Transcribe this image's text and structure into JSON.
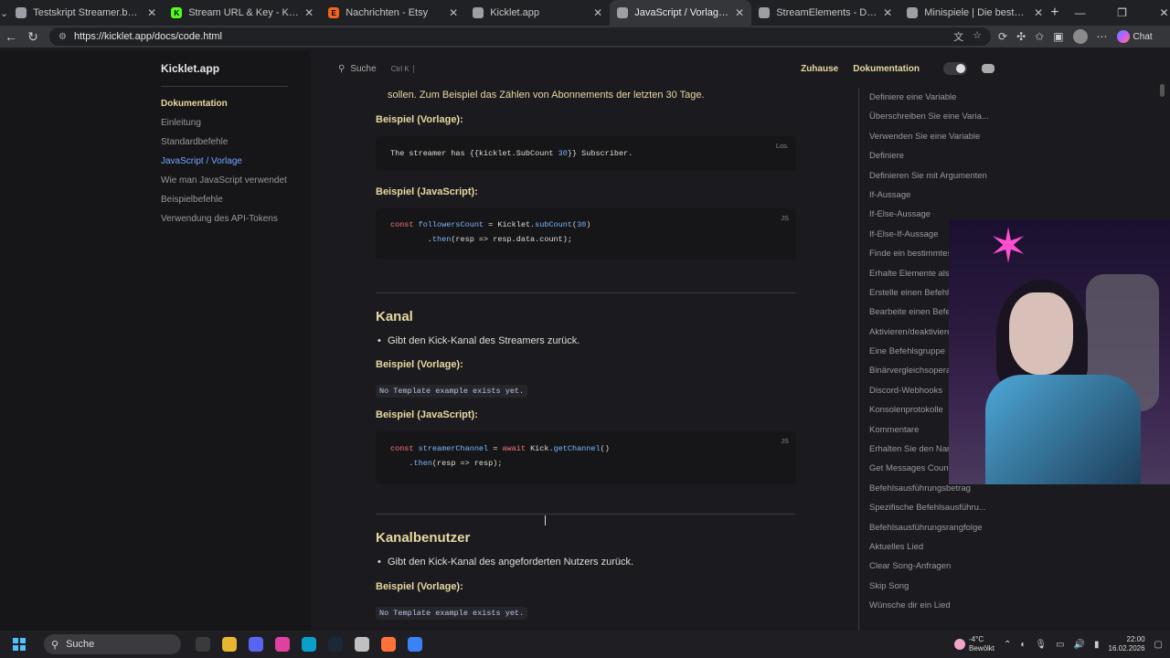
{
  "browser": {
    "tabs": [
      {
        "title": "Testskript Streamer.bot Kick",
        "fav_color": "#9aa0a6",
        "fav_glyph": ""
      },
      {
        "title": "Stream URL & Key - Kick Dashboard",
        "fav_color": "#53fc18",
        "fav_glyph": "K"
      },
      {
        "title": "Nachrichten - Etsy",
        "fav_color": "#f1641e",
        "fav_glyph": "E"
      },
      {
        "title": "Kicklet.app",
        "fav_color": "#9aa0a6",
        "fav_glyph": ""
      },
      {
        "title": "JavaScript / Vorlage | Kicklet.app",
        "fav_color": "#9aa0a6",
        "fav_glyph": ""
      },
      {
        "title": "StreamElements - Default comma",
        "fav_color": "#9aa0a6",
        "fav_glyph": ""
      },
      {
        "title": "Minispiele | Die beste Software zu",
        "fav_color": "#9aa0a6",
        "fav_glyph": ""
      }
    ],
    "url": "https://kicklet.app/docs/code.html",
    "chat_label": "Chat"
  },
  "site": {
    "brand": "Kicklet.app",
    "search_label": "Suche",
    "search_kbd": "Ctrl K",
    "nav": {
      "home": "Zuhause",
      "docs": "Dokumentation"
    }
  },
  "sidebar": {
    "items": [
      {
        "label": "Dokumentation",
        "kind": "section"
      },
      {
        "label": "Einleitung",
        "kind": "item"
      },
      {
        "label": "Standardbefehle",
        "kind": "item"
      },
      {
        "label": "JavaScript / Vorlage",
        "kind": "active"
      },
      {
        "label": "Wie man JavaScript verwendet",
        "kind": "item"
      },
      {
        "label": "Beispielbefehle",
        "kind": "item"
      },
      {
        "label": "Verwendung des API-Tokens",
        "kind": "item"
      }
    ]
  },
  "content": {
    "intro_line": "sollen. Zum Beispiel das Zählen von Abonnements der letzten 30 Tage.",
    "example_template_label": "Beispiel (Vorlage):",
    "example_js_label": "Beispiel (JavaScript):",
    "code1_lang": "Los.",
    "code1_text_a": "The streamer has {{kicklet.SubCount ",
    "code1_num": "30",
    "code1_text_b": "}} Subscriber.",
    "code2_lang": "JS",
    "code2": {
      "const": "const",
      "var": "followersCount",
      "eq": " = Kicklet.",
      "fn": "subCount",
      "open": "(",
      "num": "30",
      "close": ")",
      "line2_a": "        .",
      "then": "then",
      "line2_b": "(resp => resp.data.count);"
    },
    "sec1_heading": "Kanal",
    "sec1_bullet": "Gibt den Kick-Kanal des Streamers zurück.",
    "no_template": "No Template example exists yet.",
    "code3_lang": "JS",
    "code3": {
      "const": "const",
      "var": "streamerChannel",
      "eq": " = ",
      "await": "await",
      "obj": " Kick.",
      "fn": "getChannel",
      "paren": "()",
      "line2_a": "    .",
      "then": "then",
      "line2_b": "(resp => resp);"
    },
    "sec2_heading": "Kanalbenutzer",
    "sec2_bullet": "Gibt den Kick-Kanal des angeforderten Nutzers zurück."
  },
  "toc": {
    "items": [
      "Definiere eine Variable",
      "Überschreiben Sie eine Varia...",
      "Verwenden Sie eine Variable",
      "Definiere",
      "Definieren Sie mit Argumenten",
      "If-Aussage",
      "If-Else-Aussage",
      "If-Else-If-Aussage",
      "Finde ein bestimmtes Element",
      "Erhalte Elemente als Liste",
      "Erstelle einen Befehl",
      "Bearbeite einen Befehl",
      "Aktivieren/deaktivieren",
      "Eine Befehlsgruppe",
      "Binärvergleichsoperatoren",
      "Discord-Webhooks",
      "Konsolenprotokolle",
      "Kommentare",
      "Erhalten Sie den Namen",
      "Get Messages Count",
      "Befehlsausführungsbetrag",
      "Spezifische Befehlsausführu...",
      "Befehlsausführungsrangfolge",
      "Aktuelles Lied",
      "Clear Song-Anfragen",
      "Skip Song",
      "Wünsche dir ein Lied"
    ]
  },
  "taskbar": {
    "search": "Suche",
    "weather_temp": "-4°C",
    "weather_desc": "Bewölkt",
    "time": "22:00",
    "date": "16.02.2026",
    "apps": [
      "#3a3a3a",
      "#e8b730",
      "#5865f2",
      "#e040a0",
      "#0aa0c8",
      "#1b2838",
      "#c0c0c0",
      "#ff7139",
      "#3b82f6"
    ]
  }
}
